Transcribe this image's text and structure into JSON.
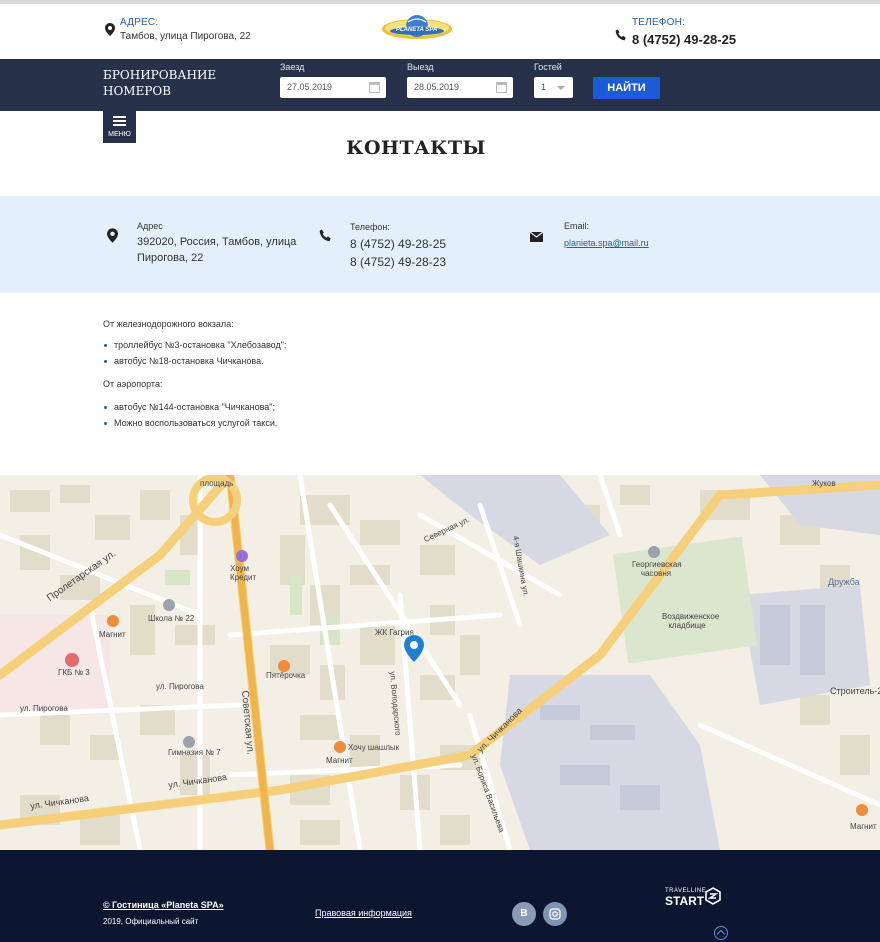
{
  "header": {
    "address_label": "АДРЕС:",
    "address_value": "Тамбов, улица Пирогова, 22",
    "logo_text": "PLANETA SPA",
    "phone_label": "ТЕЛЕФОН:",
    "phone_value": "8 (4752) 49-28-25"
  },
  "booking": {
    "title": "БРОНИРОВАНИЕ НОМЕРОВ",
    "checkin_label": "Заезд",
    "checkin_value": "27.05.2019",
    "checkout_label": "Выезд",
    "checkout_value": "28.05.2019",
    "guests_label": "Гостей",
    "guests_value": "1",
    "find_label": "НАЙТИ"
  },
  "menu": {
    "label": "МЕНЮ"
  },
  "page_title": "КОНТАКТЫ",
  "contacts": {
    "address_label": "Адрес",
    "address_line1": "392020, Россия, Тамбов, улица",
    "address_line2": "Пирогова, 22",
    "phone_label": "Телефон:",
    "phone1": "8 (4752) 49-28-25",
    "phone2": "8 (4752) 49-28-23",
    "email_label": "Email:",
    "email_value": "planieta.spa@mail.ru"
  },
  "directions": {
    "station_heading": "От железнодорожного вокзала:",
    "station_items": [
      "троллейбус №3-остановка \"Хлебозавод\";",
      "автобус №18-остановка Чичканова."
    ],
    "airport_heading": "От аэропорта:",
    "airport_items": [
      "автобус №144-остановка \"Чичканова\";",
      "Можно воспользоваться услугой такси."
    ]
  },
  "map": {
    "labels": {
      "ploshad": "площадь",
      "zhukov": "Жуков",
      "proletarskaya": "Пролетарская ул.",
      "sovetskaya": "Советская ул.",
      "chichkanova1": "ул. Чичканова",
      "chichkanova2": "ул. Чичканова",
      "chichkanova3": "ул. Чичканова",
      "pirogova1": "ул. Пирогова",
      "pirogova2": "ул. Пирогова",
      "severnaya": "Северная ул.",
      "magnit1": "Магнит",
      "magnit2": "Магнит",
      "magnit3": "Магнит",
      "hom_kredit": "Хоум Кредит",
      "pyaterochka": "Пятёрочка",
      "hochu_shashlyk": "Хочу шашлык",
      "shkola": "Школа № 22",
      "gimnaziya": "Гимназия № 7",
      "gkb": "ГКБ № 3",
      "georg": "Георгиевская часовня",
      "vozdv": "Воздвиженское кладбище",
      "druzhba": "Дружба",
      "stroitel": "Строитель-2",
      "zhk": "ЖК Гагрия",
      "volodarsky": "ул. Володарского",
      "borisa": "ул. Бориса Васильева",
      "shashky": "4-я Шашкина ул."
    }
  },
  "footer": {
    "copyright": "© Гостиница «Planeta SPA»",
    "year": "2019, Официальный сайт",
    "legal": "Правовая информация",
    "vk": "В",
    "tl_small": "TRAVELLINE",
    "tl_big": "START"
  },
  "colors": {
    "navy": "#27324a",
    "accent_blue": "#1c5bd8",
    "contacts_bg": "#e3f0fc",
    "footer_bg": "#0c1631"
  }
}
